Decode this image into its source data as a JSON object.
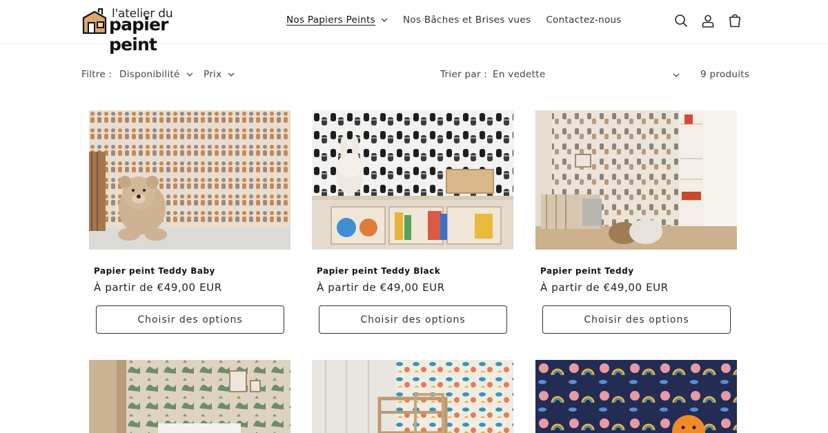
{
  "brand": {
    "logo_line1": "l'atelier du",
    "logo_line2": "papier peint"
  },
  "nav": {
    "items": [
      {
        "label": "Nos Papiers Peints",
        "active": true,
        "has_dropdown": true
      },
      {
        "label": "Nos Bâches et Brises vues",
        "active": false,
        "has_dropdown": false
      },
      {
        "label": "Contactez-nous",
        "active": false,
        "has_dropdown": false
      }
    ],
    "icons": [
      "search-icon",
      "account-icon",
      "cart-icon"
    ]
  },
  "filters": {
    "filter_label": "Filtre :",
    "availability": "Disponibilité",
    "price": "Prix",
    "sort_label": "Trier par :",
    "sort_value": "En vedette",
    "count": "9 produits"
  },
  "products": [
    {
      "title": "Papier peint Teddy Baby",
      "price": "À partir de €49,00 EUR",
      "button": "Choisir des options"
    },
    {
      "title": "Papier peint Teddy Black",
      "price": "À partir de €49,00 EUR",
      "button": "Choisir des options"
    },
    {
      "title": "Papier peint Teddy",
      "price": "À partir de €49,00 EUR",
      "button": "Choisir des options"
    },
    {
      "title": "",
      "price": "",
      "button": ""
    },
    {
      "title": "",
      "price": "",
      "button": ""
    },
    {
      "title": "",
      "price": "",
      "button": ""
    }
  ],
  "colors": {
    "text": "#1d1d1d",
    "border": "#333333",
    "divider": "#ececec"
  }
}
